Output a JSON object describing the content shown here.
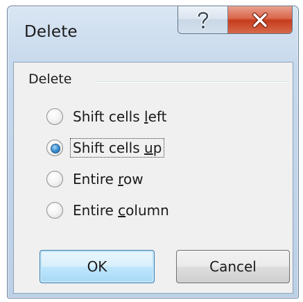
{
  "window": {
    "title": "Delete",
    "help_glyph": "?",
    "close_glyph": "X"
  },
  "group": {
    "label": "Delete"
  },
  "options": [
    {
      "text": "Shift cells left",
      "parts": [
        "Shift cells ",
        "l",
        "eft"
      ],
      "checked": false
    },
    {
      "text": "Shift cells up",
      "parts": [
        "Shift cells ",
        "u",
        "p"
      ],
      "checked": true
    },
    {
      "text": "Entire row",
      "parts": [
        "Entire ",
        "r",
        "ow"
      ],
      "checked": false
    },
    {
      "text": "Entire column",
      "parts": [
        "Entire ",
        "c",
        "olumn"
      ],
      "checked": false
    }
  ],
  "buttons": {
    "ok": "OK",
    "cancel": "Cancel"
  },
  "colors": {
    "close_red": "#c63b1c",
    "default_button_blue": "#3c7fb1",
    "selected_radio_blue": "#3a8fd1"
  }
}
